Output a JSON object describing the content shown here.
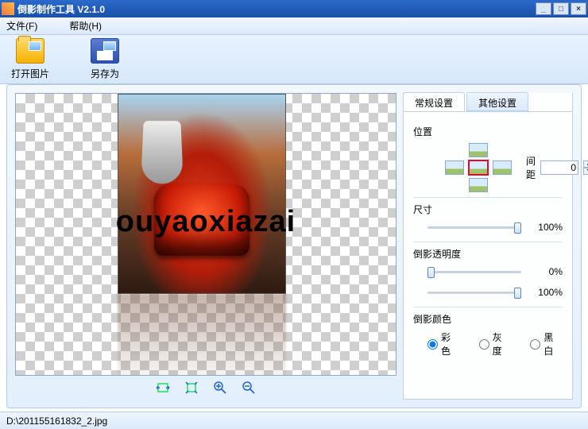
{
  "window": {
    "title": "倒影制作工具  V2.1.0"
  },
  "menu": {
    "file": "文件(F)",
    "help": "帮助(H)"
  },
  "toolbar": {
    "open": "打开图片",
    "saveas": "另存为"
  },
  "watermark": "ouyaoxiazai",
  "tabs": {
    "general": "常规设置",
    "other": "其他设置"
  },
  "panel": {
    "position_label": "位置",
    "spacing_label": "间距",
    "spacing_value": "0",
    "size_label": "尺寸",
    "size_pct": "100%",
    "opacity_label": "倒影透明度",
    "opacity_top_pct": "0%",
    "opacity_bottom_pct": "100%",
    "color_label": "倒影颜色",
    "radios": {
      "color": "彩色",
      "gray": "灰度",
      "bw": "黑白"
    }
  },
  "status": {
    "path": "D:\\201155161832_2.jpg"
  }
}
